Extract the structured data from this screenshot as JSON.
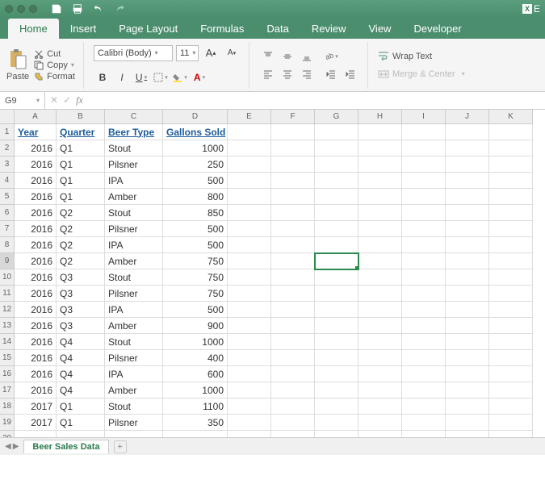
{
  "app": {
    "right_label": "E"
  },
  "tabs": [
    "Home",
    "Insert",
    "Page Layout",
    "Formulas",
    "Data",
    "Review",
    "View",
    "Developer"
  ],
  "active_tab": 0,
  "ribbon": {
    "paste": "Paste",
    "cut": "Cut",
    "copy": "Copy",
    "format": "Format",
    "font_name": "Calibri (Body)",
    "font_size": "11",
    "bold": "B",
    "italic": "I",
    "underline": "U",
    "wrap": "Wrap Text",
    "merge": "Merge & Center",
    "font_bigger": "A",
    "font_smaller": "A"
  },
  "name_box": "G9",
  "formula": "",
  "columns": [
    "A",
    "B",
    "C",
    "D",
    "E",
    "F",
    "G",
    "H",
    "I",
    "J",
    "K"
  ],
  "headers": [
    "Year",
    "Quarter",
    "Beer Type",
    "Gallons Sold"
  ],
  "rows": [
    {
      "year": 2016,
      "quarter": "Q1",
      "type": "Stout",
      "gallons": 1000
    },
    {
      "year": 2016,
      "quarter": "Q1",
      "type": "Pilsner",
      "gallons": 250
    },
    {
      "year": 2016,
      "quarter": "Q1",
      "type": "IPA",
      "gallons": 500
    },
    {
      "year": 2016,
      "quarter": "Q1",
      "type": "Amber",
      "gallons": 800
    },
    {
      "year": 2016,
      "quarter": "Q2",
      "type": "Stout",
      "gallons": 850
    },
    {
      "year": 2016,
      "quarter": "Q2",
      "type": "Pilsner",
      "gallons": 500
    },
    {
      "year": 2016,
      "quarter": "Q2",
      "type": "IPA",
      "gallons": 500
    },
    {
      "year": 2016,
      "quarter": "Q2",
      "type": "Amber",
      "gallons": 750
    },
    {
      "year": 2016,
      "quarter": "Q3",
      "type": "Stout",
      "gallons": 750
    },
    {
      "year": 2016,
      "quarter": "Q3",
      "type": "Pilsner",
      "gallons": 750
    },
    {
      "year": 2016,
      "quarter": "Q3",
      "type": "IPA",
      "gallons": 500
    },
    {
      "year": 2016,
      "quarter": "Q3",
      "type": "Amber",
      "gallons": 900
    },
    {
      "year": 2016,
      "quarter": "Q4",
      "type": "Stout",
      "gallons": 1000
    },
    {
      "year": 2016,
      "quarter": "Q4",
      "type": "Pilsner",
      "gallons": 400
    },
    {
      "year": 2016,
      "quarter": "Q4",
      "type": "IPA",
      "gallons": 600
    },
    {
      "year": 2016,
      "quarter": "Q4",
      "type": "Amber",
      "gallons": 1000
    },
    {
      "year": 2017,
      "quarter": "Q1",
      "type": "Stout",
      "gallons": 1100
    },
    {
      "year": 2017,
      "quarter": "Q1",
      "type": "Pilsner",
      "gallons": 350
    }
  ],
  "visible_row_count": 20,
  "selected_cell": {
    "col": "G",
    "row": 9
  },
  "sheet_tab": "Beer Sales Data"
}
